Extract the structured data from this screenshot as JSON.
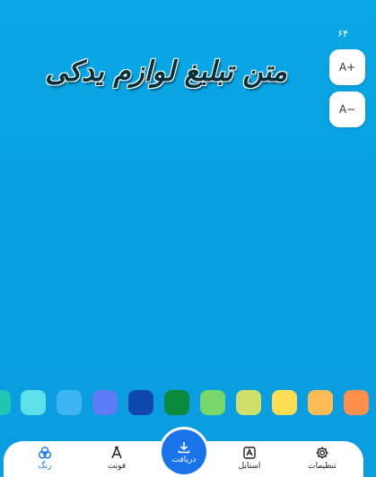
{
  "font_size": {
    "value": "۶۴",
    "increase_label": "A+",
    "decrease_label": "A−"
  },
  "headline": {
    "text": "متن تبلیغ لوازم یدکی"
  },
  "palette": {
    "colors": [
      "#20c6b0",
      "#5ee0ea",
      "#3fb4f2",
      "#5b7cf5",
      "#1048b0",
      "#0b8a3e",
      "#78d76a",
      "#cfe06a",
      "#ffdd55",
      "#ffbb55",
      "#ff8f4a"
    ]
  },
  "nav": {
    "settings": {
      "label": "تنظیمات",
      "icon": "gear-icon"
    },
    "style": {
      "label": "استایل",
      "icon": "style-icon"
    },
    "download": {
      "label": "دریافت",
      "icon": "download-icon"
    },
    "font": {
      "label": "فونت",
      "icon": "font-icon"
    },
    "color": {
      "label": "رنگ",
      "icon": "color-circles-icon"
    }
  },
  "colors": {
    "accent": "#1a73e8",
    "background": "#0ba8e6"
  }
}
